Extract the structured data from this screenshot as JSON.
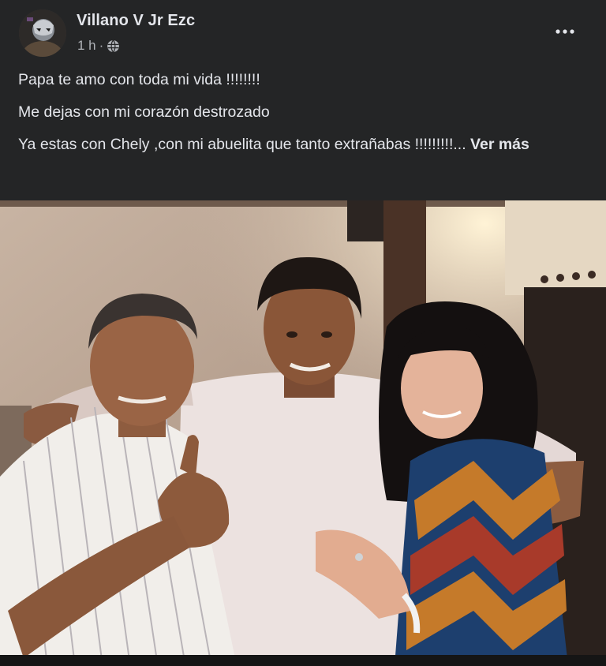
{
  "post": {
    "author": "Villano V Jr Ezc",
    "time": "1 h",
    "separator": "·",
    "audience_icon": "globe-icon",
    "more_icon": "more-options-icon",
    "more_label": "•••",
    "lines": [
      "Papa te amo con toda mi vida !!!!!!!!",
      "Me dejas con mi corazón destrozado",
      "Ya estas con Chely ,con mi abuelita que tanto extrañabas !!!!!!!!!..."
    ],
    "see_more": "Ver más"
  },
  "colors": {
    "background": "#242526",
    "primary_text": "#e4e6eb",
    "secondary_text": "#b0b3b8"
  }
}
